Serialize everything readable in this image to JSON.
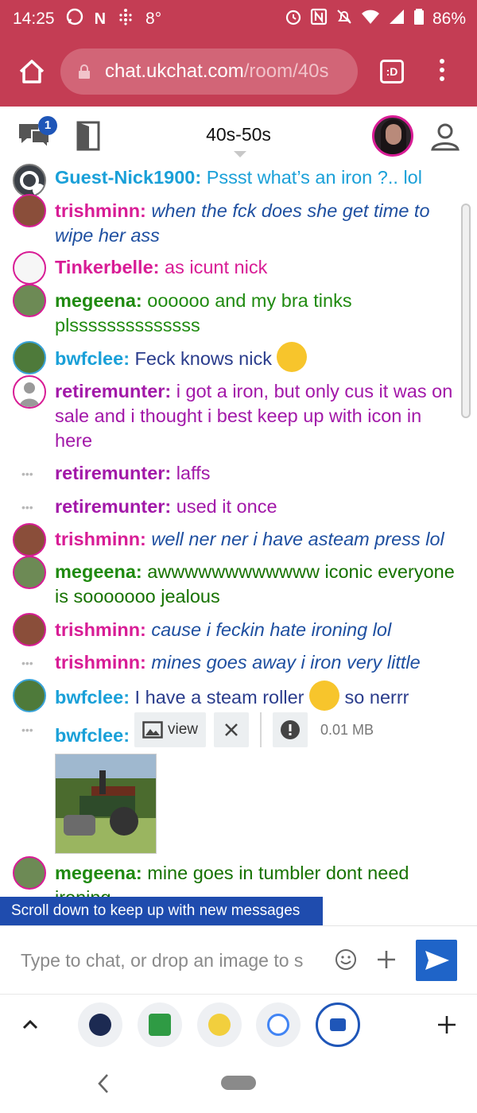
{
  "status_bar": {
    "time": "14:25",
    "temperature": "8°",
    "battery": "86%",
    "left_icons": [
      "whatsapp-icon",
      "n-icon",
      "fitbit-icon"
    ],
    "right_icons": [
      "alarm-icon",
      "nfc-icon",
      "mute-icon",
      "wifi-icon",
      "signal-icon",
      "battery-icon"
    ]
  },
  "browser": {
    "url_host": "chat.ukchat.com",
    "url_path": "/room/40s",
    "tab_label": ":D"
  },
  "chat_header": {
    "notification_count": "1",
    "room_title": "40s-50s"
  },
  "messages": [
    {
      "user": "Guest-Nick1900:",
      "text": " Pssst what’s an iron ?.. lol"
    },
    {
      "user": "trishminn:",
      "text": " when the fck does she get time to wipe her ass"
    },
    {
      "user": "Tinkerbelle:",
      "text": " as icunt nick"
    },
    {
      "user": "megeena:",
      "text": " oooooo and my bra tinks plssssssssssssss"
    },
    {
      "user": "bwfclee:",
      "text": " Feck knows nick "
    },
    {
      "user": "retiremunter:",
      "text": " i got a iron, but only cus it was on sale and i thought i best keep up with icon in here"
    },
    {
      "user": "retiremunter:",
      "text": " laffs"
    },
    {
      "user": "retiremunter:",
      "text": " used it once"
    },
    {
      "user": "trishminn:",
      "text": " well ner ner i have asteam press lol"
    },
    {
      "user": "megeena:",
      "text": " awwwwwwwwwwww iconic everyone is sooooooo jealous"
    },
    {
      "user": "trishminn:",
      "text": " cause i feckin hate ironing lol"
    },
    {
      "user": "trishminn:",
      "text": " mines goes away i iron very little"
    },
    {
      "user": "bwfclee:",
      "text": " I have a steam roller ",
      "text_after": " so nerrr"
    },
    {
      "user": "bwfclee:",
      "view_label": "view",
      "file_size": "0.01 MB"
    },
    {
      "user": "megeena:",
      "text": " mine goes in tumbler dont need ironing"
    }
  ],
  "scroll_banner": "Scroll down to keep up with new messages",
  "chat_input": {
    "placeholder": "Type to chat, or drop an image to s"
  },
  "colors": {
    "brand": "#c43d54",
    "accent": "#1f4cae",
    "send": "#1f64c8"
  }
}
